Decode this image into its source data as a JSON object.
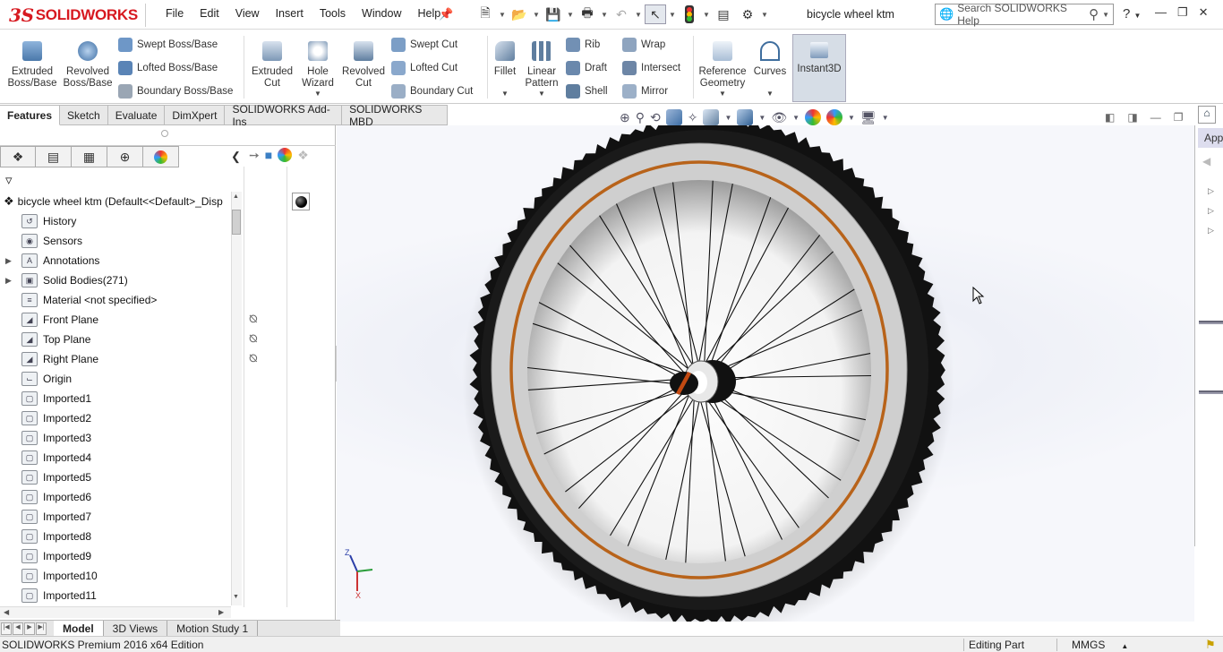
{
  "app": {
    "logo_text": "SOLIDWORKS",
    "logo_prefix": "3S",
    "document_title": "bicycle wheel ktm",
    "search_placeholder": "Search SOLIDWORKS Help",
    "help_icon": "question-icon"
  },
  "menus": [
    "File",
    "Edit",
    "View",
    "Insert",
    "Tools",
    "Window",
    "Help"
  ],
  "quick_access_icons": [
    "new-document-icon",
    "open-icon",
    "save-icon",
    "print-icon",
    "undo-icon",
    "select-icon",
    "rebuild-icon",
    "file-properties-icon",
    "options-icon"
  ],
  "command_manager": {
    "extruded_boss": "Extruded\nBoss/Base",
    "revolved_boss": "Revolved\nBoss/Base",
    "swept_boss": "Swept Boss/Base",
    "lofted_boss": "Lofted Boss/Base",
    "boundary_boss": "Boundary Boss/Base",
    "extruded_cut": "Extruded\nCut",
    "hole_wizard": "Hole\nWizard",
    "revolved_cut": "Revolved\nCut",
    "swept_cut": "Swept Cut",
    "lofted_cut": "Lofted Cut",
    "boundary_cut": "Boundary Cut",
    "fillet": "Fillet",
    "linear_pattern": "Linear\nPattern",
    "rib": "Rib",
    "draft": "Draft",
    "shell": "Shell",
    "wrap": "Wrap",
    "intersect": "Intersect",
    "mirror": "Mirror",
    "reference_geometry": "Reference\nGeometry",
    "curves": "Curves",
    "instant3d": "Instant3D"
  },
  "tabs": [
    "Features",
    "Sketch",
    "Evaluate",
    "DimXpert",
    "SOLIDWORKS Add-Ins",
    "SOLIDWORKS MBD"
  ],
  "active_tab": "Features",
  "feature_tree": {
    "root": "bicycle wheel ktm  (Default<<Default>_Disp",
    "items": [
      {
        "label": "History",
        "icon": "history-icon",
        "expandable": false
      },
      {
        "label": "Sensors",
        "icon": "sensor-icon",
        "expandable": false
      },
      {
        "label": "Annotations",
        "icon": "annotation-icon",
        "expandable": true
      },
      {
        "label": "Solid Bodies(271)",
        "icon": "solid-bodies-icon",
        "expandable": true
      },
      {
        "label": "Material <not specified>",
        "icon": "material-icon",
        "expandable": false
      },
      {
        "label": "Front Plane",
        "icon": "plane-icon",
        "expandable": false
      },
      {
        "label": "Top Plane",
        "icon": "plane-icon",
        "expandable": false
      },
      {
        "label": "Right Plane",
        "icon": "plane-icon",
        "expandable": false
      },
      {
        "label": "Origin",
        "icon": "origin-icon",
        "expandable": false
      },
      {
        "label": "Imported1",
        "icon": "imported-body-icon",
        "expandable": false
      },
      {
        "label": "Imported2",
        "icon": "imported-body-icon",
        "expandable": false
      },
      {
        "label": "Imported3",
        "icon": "imported-body-icon",
        "expandable": false
      },
      {
        "label": "Imported4",
        "icon": "imported-body-icon",
        "expandable": false
      },
      {
        "label": "Imported5",
        "icon": "imported-body-icon",
        "expandable": false
      },
      {
        "label": "Imported6",
        "icon": "imported-body-icon",
        "expandable": false
      },
      {
        "label": "Imported7",
        "icon": "imported-body-icon",
        "expandable": false
      },
      {
        "label": "Imported8",
        "icon": "imported-body-icon",
        "expandable": false
      },
      {
        "label": "Imported9",
        "icon": "imported-body-icon",
        "expandable": false
      },
      {
        "label": "Imported10",
        "icon": "imported-body-icon",
        "expandable": false
      },
      {
        "label": "Imported11",
        "icon": "imported-body-icon",
        "expandable": false
      }
    ]
  },
  "task_pane": {
    "label": "App"
  },
  "bottom_tabs": [
    "Model",
    "3D Views",
    "Motion Study 1"
  ],
  "active_bottom_tab": "Model",
  "status_bar": {
    "product": "SOLIDWORKS Premium 2016 x64 Edition",
    "mode": "Editing Part",
    "units": "MMGS"
  },
  "triad": {
    "z": "Z",
    "x": "X"
  },
  "wheel": {
    "spoke_count": 36,
    "colors": {
      "tire": "#111111",
      "rim": "#c8c8c8",
      "rim_stripe": "#b8631a",
      "hub": "#111111",
      "hub_accent": "#c24a12",
      "spoke": "#111111"
    }
  },
  "colors": {
    "brand": "#d71920",
    "accent": "#2b6cc4",
    "selected_button": "#d6dde6"
  }
}
